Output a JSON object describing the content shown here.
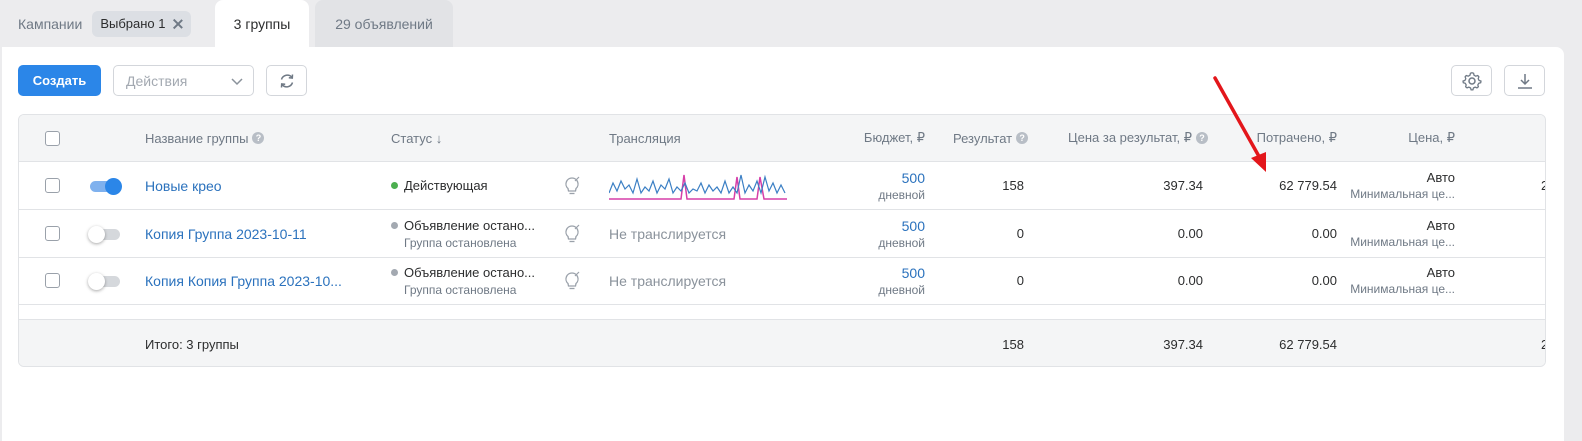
{
  "tabs": {
    "campaigns_label": "Кампании",
    "selected_chip": "Выбрано 1",
    "groups_label": "3 группы",
    "ads_label": "29 объявлений"
  },
  "toolbar": {
    "create_label": "Создать",
    "actions_placeholder": "Действия"
  },
  "table": {
    "headers": {
      "name": "Название группы",
      "status": "Статус ↓",
      "broadcast": "Трансляция",
      "budget": "Бюджет, ₽",
      "result": "Результат",
      "cost_per_result": "Цена за результат, ₽",
      "spent": "Потрачено, ₽",
      "price": "Цена, ₽"
    },
    "rows": [
      {
        "enabled": true,
        "name": "Новые крео",
        "status": "Действующая",
        "status_color": "#4caf50",
        "status_sub": "",
        "broadcast": "",
        "budget": "500",
        "budget_period": "дневной",
        "result": "158",
        "cost_per_result": "397.34",
        "spent": "62 779.54",
        "price": "Авто",
        "price_sub": "Минимальная це...",
        "overflow": "2"
      },
      {
        "enabled": false,
        "name": "Копия Группа 2023-10-11",
        "status": "Объявление остано...",
        "status_color": "#a3a9b1",
        "status_sub": "Группа остановлена",
        "broadcast": "Не транслируется",
        "budget": "500",
        "budget_period": "дневной",
        "result": "0",
        "cost_per_result": "0.00",
        "spent": "0.00",
        "price": "Авто",
        "price_sub": "Минимальная це..."
      },
      {
        "enabled": false,
        "name": "Копия Копия Группа 2023-10...",
        "status": "Объявление остано...",
        "status_color": "#a3a9b1",
        "status_sub": "Группа остановлена",
        "broadcast": "Не транслируется",
        "budget": "500",
        "budget_period": "дневной",
        "result": "0",
        "cost_per_result": "0.00",
        "spent": "0.00",
        "price": "Авто",
        "price_sub": "Минимальная це..."
      }
    ],
    "footer": {
      "total_label": "Итого: 3 группы",
      "result": "158",
      "cost_per_result": "397.34",
      "spent": "62 779.54",
      "overflow": "2"
    }
  },
  "colors": {
    "accent": "#2b86e8",
    "link": "#2b72bd",
    "annotation_arrow": "#e3161b",
    "sparkline_blue": "#3b7fc4",
    "sparkline_pink": "#d63fa8"
  },
  "icons": [
    "close-icon",
    "chevron-down-icon",
    "refresh-icon",
    "gear-icon",
    "download-icon",
    "lightbulb-icon",
    "help-icon"
  ]
}
